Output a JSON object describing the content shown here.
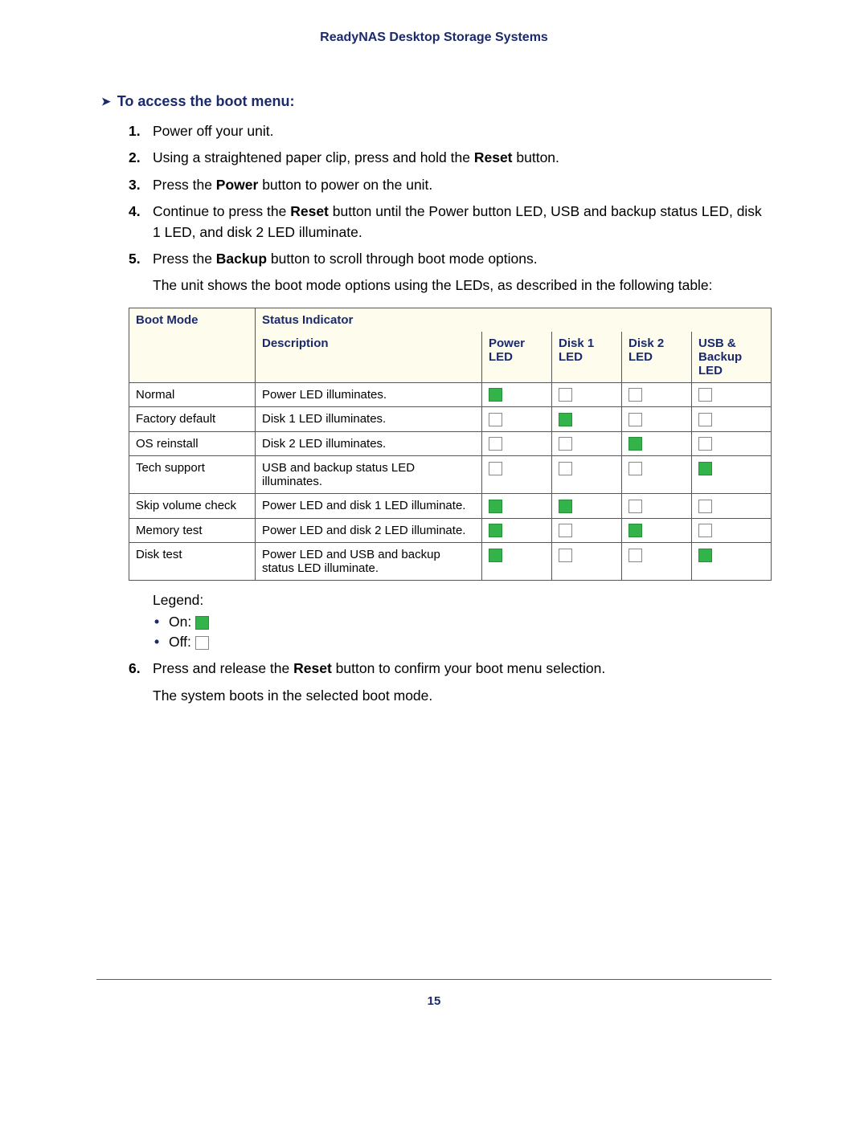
{
  "header": {
    "title": "ReadyNAS Desktop Storage Systems"
  },
  "section": {
    "heading": "To access the boot menu:"
  },
  "steps": {
    "s1": {
      "num": "1.",
      "text": "Power off your unit."
    },
    "s2": {
      "num": "2.",
      "pre": "Using a straightened paper clip, press and hold the ",
      "bold": "Reset",
      "post": " button."
    },
    "s3": {
      "num": "3.",
      "pre": "Press the ",
      "bold": "Power",
      "post": " button to power on the unit."
    },
    "s4": {
      "num": "4.",
      "pre": "Continue to press the ",
      "bold": "Reset",
      "post": " button until the Power button LED, USB and backup status LED, disk 1 LED, and disk 2 LED illuminate."
    },
    "s5": {
      "num": "5.",
      "pre": "Press the ",
      "bold": "Backup",
      "post": " button to scroll through boot mode options.",
      "para": "The unit shows the boot mode options using the LEDs, as described in the following table:"
    },
    "s6": {
      "num": "6.",
      "pre": "Press and release the ",
      "bold": "Reset",
      "post": " button to confirm your boot menu selection.",
      "para": "The system boots in the selected boot mode."
    }
  },
  "table": {
    "headers": {
      "boot_mode": "Boot Mode",
      "status_indicator": "Status Indicator",
      "description": "Description",
      "power_led": "Power LED",
      "disk1_led": "Disk 1 LED",
      "disk2_led": "Disk 2 LED",
      "usb_led": "USB & Backup LED"
    },
    "rows": [
      {
        "mode": "Normal",
        "desc": "Power LED illuminates.",
        "power": true,
        "disk1": false,
        "disk2": false,
        "usb": false
      },
      {
        "mode": "Factory default",
        "desc": "Disk 1 LED illuminates.",
        "power": false,
        "disk1": true,
        "disk2": false,
        "usb": false
      },
      {
        "mode": "OS reinstall",
        "desc": "Disk 2 LED illuminates.",
        "power": false,
        "disk1": false,
        "disk2": true,
        "usb": false
      },
      {
        "mode": "Tech support",
        "desc": "USB and backup status LED illuminates.",
        "power": false,
        "disk1": false,
        "disk2": false,
        "usb": true
      },
      {
        "mode": "Skip volume check",
        "desc": "Power LED and disk 1 LED illuminate.",
        "power": true,
        "disk1": true,
        "disk2": false,
        "usb": false
      },
      {
        "mode": "Memory test",
        "desc": "Power LED and disk 2 LED illuminate.",
        "power": true,
        "disk1": false,
        "disk2": true,
        "usb": false
      },
      {
        "mode": "Disk test",
        "desc": "Power LED and USB and backup status LED illuminate.",
        "power": true,
        "disk1": false,
        "disk2": false,
        "usb": true
      }
    ]
  },
  "legend": {
    "title": "Legend:",
    "on": "On:",
    "off": "Off:"
  },
  "page_number": "15"
}
